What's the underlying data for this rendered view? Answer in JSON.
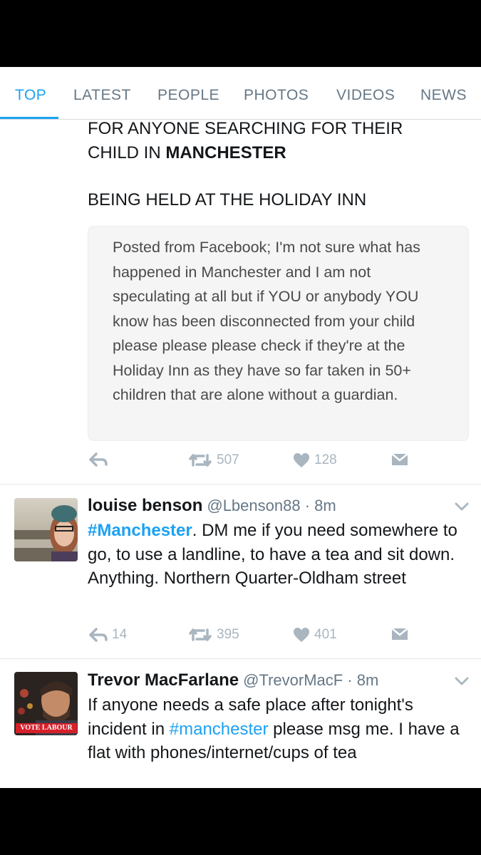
{
  "tabs": [
    "TOP",
    "LATEST",
    "PEOPLE",
    "PHOTOS",
    "VIDEOS",
    "NEWS"
  ],
  "top_tweet": {
    "line1": "FOR ANYONE SEARCHING FOR THEIR",
    "line2_prefix": "CHILD IN ",
    "line2_bold": "MANCHESTER",
    "line3": "BEING HELD AT THE HOLIDAY INN",
    "fb_image_text": "Posted from Facebook; I'm not sure what has happened in Manchester and I am not speculating at all but if YOU or anybody YOU know has been disconnected from your child please please please check if they're at the Holiday Inn as they have so far taken in 50+ children that are alone without a guardian.",
    "retweets": "507",
    "likes": "128"
  },
  "tweet2": {
    "name": "louise benson",
    "handle": "@Lbenson88 · 8m",
    "hashtag": "#Manchester",
    "text_after_tag": ". DM me if you need somewhere to go, to use a landline, to have a tea and sit down. Anything. Northern Quarter-Oldham street",
    "replies": "14",
    "retweets": "395",
    "likes": "401"
  },
  "tweet3": {
    "name": "Trevor MacFarlane",
    "handle": "@TrevorMacF · 8m",
    "text_before_tag": "If anyone needs a safe place after tonight's incident in ",
    "hashtag": "#manchester",
    "text_after_tag": " please msg me. I have a flat with phones/internet/cups of tea",
    "avatar_badge": "VOTE LABOUR"
  },
  "colors": {
    "accent": "#1da1f2",
    "icon_grey": "#a9b5bf",
    "text": "#14171a",
    "secondary": "#657786"
  },
  "icons": [
    "reply-icon",
    "retweet-icon",
    "heart-icon",
    "direct-message-icon",
    "chevron-down-icon"
  ]
}
